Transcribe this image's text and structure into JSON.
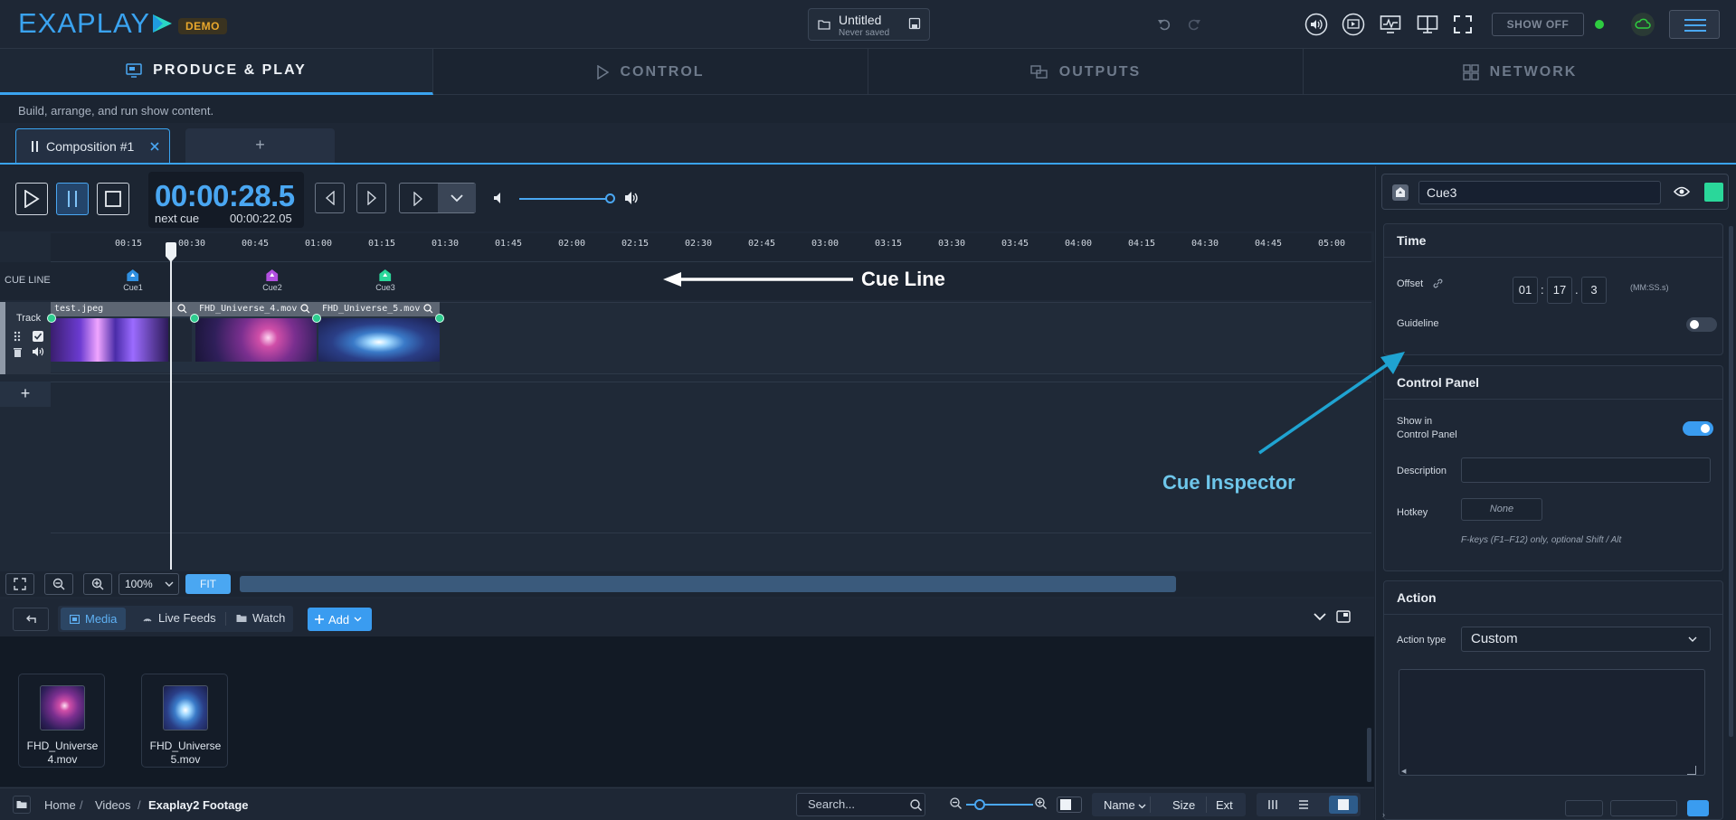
{
  "app": {
    "logo": "EXAPLAY",
    "badge": "DEMO",
    "doc_title": "Untitled",
    "doc_status": "Never saved",
    "show_off": "SHOW OFF",
    "colors": {
      "accent": "#3aa3f0",
      "online": "#2ecc40",
      "cue_color": "#2ad79a"
    }
  },
  "main_tabs": [
    {
      "label": "PRODUCE & PLAY",
      "icon": "monitor-icon",
      "active": true
    },
    {
      "label": "CONTROL",
      "icon": "play-outline-icon",
      "active": false
    },
    {
      "label": "OUTPUTS",
      "icon": "outputs-icon",
      "active": false
    },
    {
      "label": "NETWORK",
      "icon": "grid-icon",
      "active": false
    }
  ],
  "subtitle": "Build, arrange, and run show content.",
  "composition_tab": {
    "label": "Composition #1",
    "add": "+"
  },
  "transport": {
    "timecode": "00:00:28.5",
    "next_label": "next cue",
    "next_value": "00:00:22.05",
    "volume": 0.85
  },
  "ruler_ticks": [
    "00:15",
    "00:30",
    "00:45",
    "01:00",
    "01:15",
    "01:30",
    "01:45",
    "02:00",
    "02:15",
    "02:30",
    "02:45",
    "03:00",
    "03:15",
    "03:30",
    "03:45",
    "04:00",
    "04:15",
    "04:30",
    "04:45",
    "05:00"
  ],
  "cue_line": {
    "label": "CUE LINE",
    "cues": [
      {
        "name": "Cue1",
        "color": "#2f8fe0"
      },
      {
        "name": "Cue2",
        "color": "#b24fe0"
      },
      {
        "name": "Cue3",
        "color": "#2ad79a"
      }
    ],
    "annotation": "Cue Line"
  },
  "track": {
    "label": "Track",
    "clips": [
      {
        "name": "test.jpeg"
      },
      {
        "name": "FHD_Universe_4.mov"
      },
      {
        "name": "FHD_Universe_5.mov"
      }
    ],
    "add": "+"
  },
  "zoom": {
    "value": "100%",
    "fit": "FIT"
  },
  "media_bar": {
    "tabs": [
      "Media",
      "Live Feeds",
      "Watch"
    ],
    "add": "Add"
  },
  "media_items": [
    {
      "name_line1": "FHD_Universe",
      "name_line2": "4.mov"
    },
    {
      "name_line1": "FHD_Universe",
      "name_line2": "5.mov"
    }
  ],
  "breadcrumb": [
    "Home",
    "Videos",
    "Exaplay2 Footage"
  ],
  "browser": {
    "search_placeholder": "Search...",
    "sort": [
      "Name",
      "Size",
      "Ext"
    ]
  },
  "inspector": {
    "cue_name": "Cue3",
    "annotation": "Cue Inspector",
    "time": {
      "title": "Time",
      "offset_label": "Offset",
      "offset": [
        "01",
        "17",
        "3"
      ],
      "offset_unit": "(MM:SS.s)",
      "guideline_label": "Guideline",
      "guideline_on": false
    },
    "control_panel": {
      "title": "Control Panel",
      "show_label_1": "Show in",
      "show_label_2": "Control Panel",
      "show_on": true,
      "description_label": "Description",
      "description_value": "",
      "hotkey_label": "Hotkey",
      "hotkey_value": "None",
      "hotkey_hint": "F-keys (F1–F12) only, optional Shift / Alt"
    },
    "action": {
      "title": "Action",
      "type_label": "Action type",
      "type_value": "Custom"
    }
  }
}
